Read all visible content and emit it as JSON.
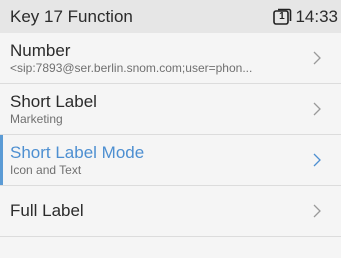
{
  "header": {
    "title": "Key 17 Function",
    "line_number": "1",
    "time": "14:33"
  },
  "items": [
    {
      "title": "Number",
      "subtitle": "<sip:7893@ser.berlin.snom.com;user=phon..."
    },
    {
      "title": "Short Label",
      "subtitle": "Marketing"
    },
    {
      "title": "Short Label Mode",
      "subtitle": "Icon and Text",
      "selected": true
    },
    {
      "title": "Full Label"
    }
  ],
  "colors": {
    "accent": "#4d8fd1",
    "header_bg": "#e6e6e6",
    "background": "#f5f5f5"
  },
  "icons": {
    "line": "line-status-icon",
    "chevron": "chevron-right-icon"
  }
}
